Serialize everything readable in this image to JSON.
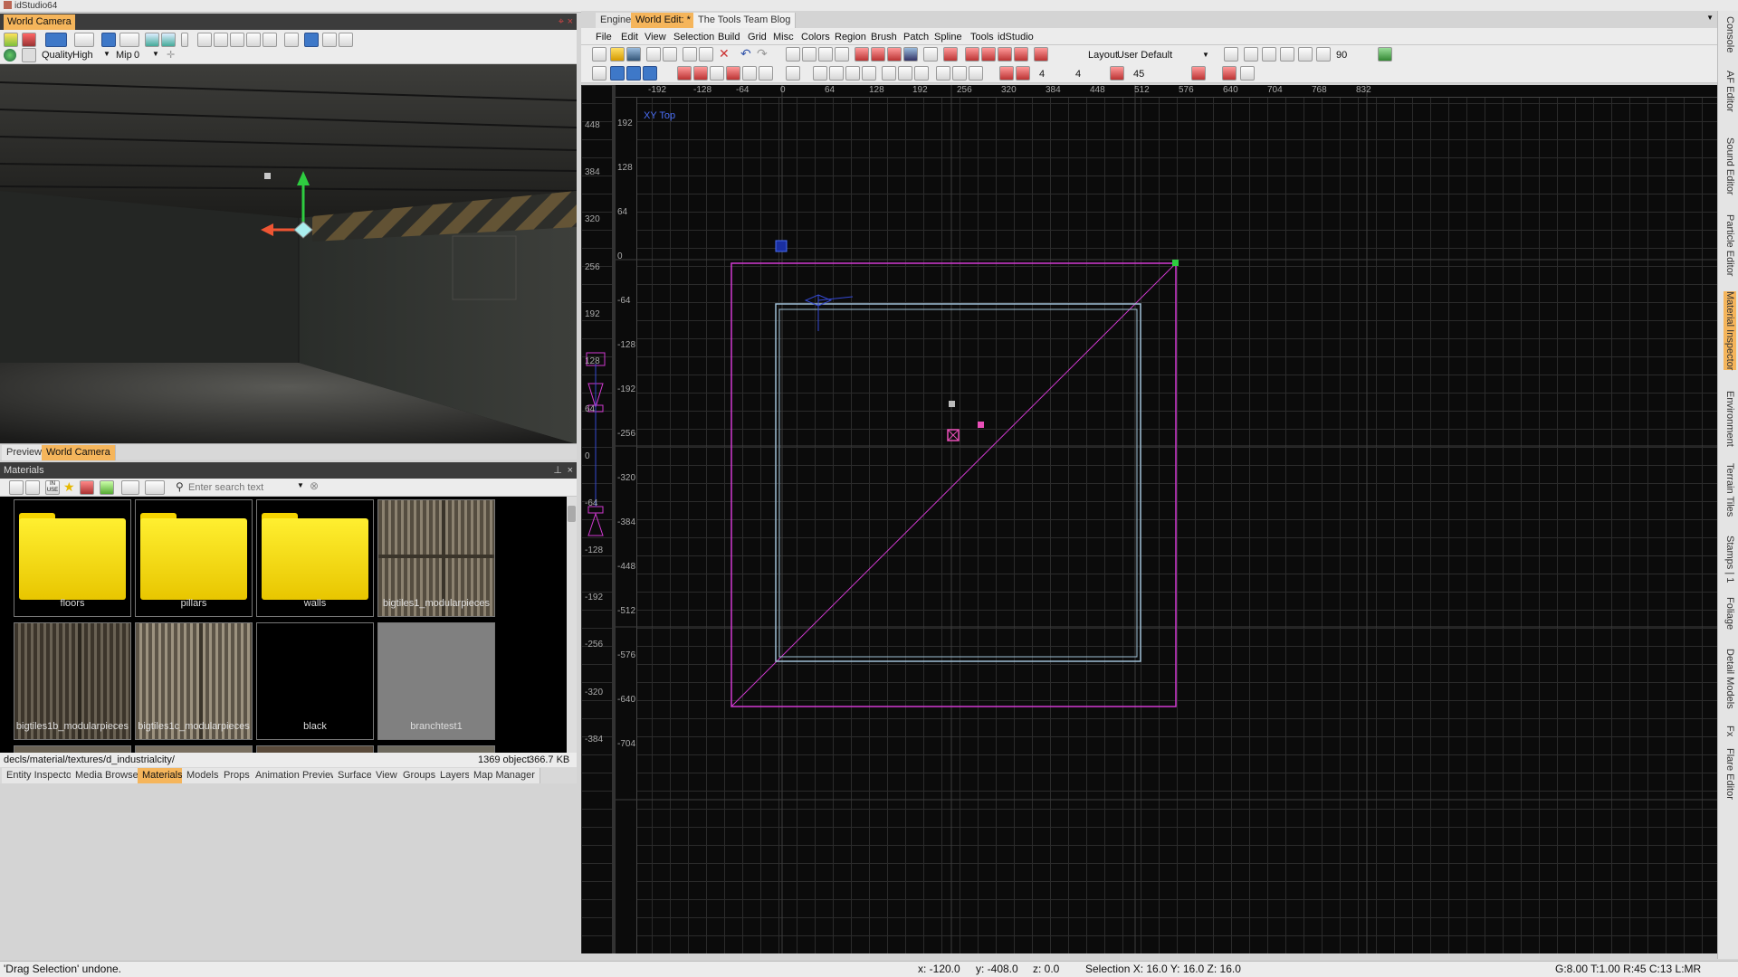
{
  "app": {
    "title": "idStudio64"
  },
  "camera": {
    "title": "World Camera",
    "quality_label": "Quality",
    "quality_value": "High",
    "mip_label": "Mip",
    "mip_value": "0",
    "tabs": [
      "Preview",
      "World Camera"
    ]
  },
  "materials": {
    "title": "Materials",
    "search_placeholder": "Enter search text",
    "items": [
      {
        "label": "floors",
        "kind": "folder"
      },
      {
        "label": "pillars",
        "kind": "folder"
      },
      {
        "label": "walls",
        "kind": "folder"
      },
      {
        "label": "bigtiles1_modularpieces",
        "kind": "texture"
      },
      {
        "label": "bigtiles1b_modularpieces",
        "kind": "texture"
      },
      {
        "label": "bigtiles1c_modularpieces",
        "kind": "texture"
      },
      {
        "label": "black",
        "kind": "black"
      },
      {
        "label": "branchtest1",
        "kind": "gray"
      }
    ],
    "path": "decls/material/textures/d_industrialcity/",
    "count": "1369 object",
    "size": "366.7 KB"
  },
  "bottom_tabs": [
    "Entity Inspector",
    "Media Browser",
    "Materials",
    "Models",
    "Props",
    "Animation Preview",
    "Surface",
    "View",
    "Groups",
    "Layers",
    "Map Manager"
  ],
  "status": {
    "message": "'Drag Selection' undone.",
    "x": "x:  -120.0",
    "y": "y:  -408.0",
    "z": "z:  0.0",
    "selection": "Selection X:  16.0  Y:  16.0  Z:  16.0",
    "right": "G:8.00  T:1.00  R:45  C:13  L:MR"
  },
  "world_tabs": [
    "Engine",
    "World Edit: *",
    "The Tools Team Blog"
  ],
  "menu": [
    "File",
    "Edit",
    "View",
    "Selection",
    "Build",
    "Grid",
    "Misc",
    "Colors",
    "Region",
    "Brush",
    "Patch",
    "Spline",
    "Tools",
    "idStudio"
  ],
  "toolbar": {
    "layout_label": "Layout",
    "layout_value": "User Default",
    "angle": "90",
    "grid_a": "4",
    "grid_b": "4",
    "rot": "45"
  },
  "view": {
    "label": "XY Top",
    "x_ticks": [
      "-192",
      "-128",
      "-64",
      "0",
      "64",
      "128",
      "192",
      "256",
      "320",
      "384",
      "448",
      "512",
      "576",
      "640",
      "704",
      "768",
      "832"
    ],
    "y_ticks": [
      "192",
      "128",
      "64",
      "0",
      "-64",
      "-128",
      "-192",
      "-256",
      "-320",
      "-384",
      "-448",
      "-512",
      "-576",
      "-640",
      "-704"
    ],
    "z_ticks": [
      "448",
      "384",
      "320",
      "256",
      "192",
      "128",
      "64",
      "0",
      "-64",
      "-128",
      "-192",
      "-256",
      "-320",
      "-384"
    ]
  },
  "side_tabs": [
    "Console",
    "AF Editor",
    "Sound Editor",
    "Particle Editor",
    "Material Inspector",
    "Environment",
    "Terrain Tiles",
    "Stamps | 1",
    "Foliage",
    "Detail Models",
    "Fx",
    "Flare Editor"
  ]
}
